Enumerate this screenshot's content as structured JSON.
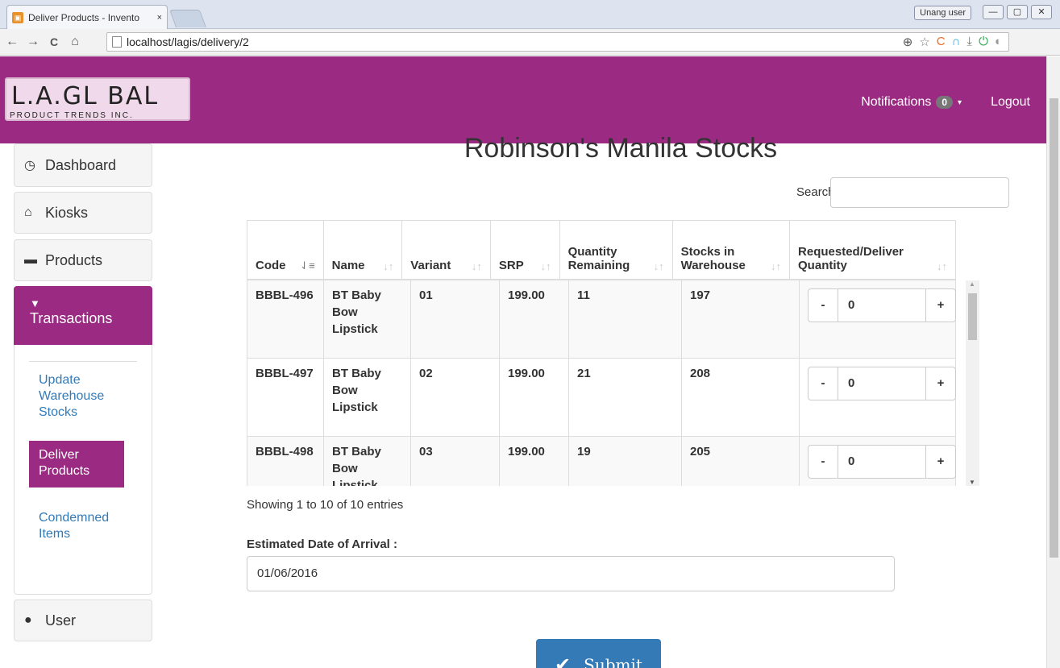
{
  "browser": {
    "tab_title": "Deliver Products - Invento",
    "tab_close": "×",
    "favicon": "📦",
    "user_chip": "Unang user",
    "win_min": "—",
    "win_max": "▢",
    "win_close": "✕",
    "back": "←",
    "forward": "→",
    "reload": "C",
    "home": "⌂",
    "url": "localhost/lagis/delivery/2",
    "menu": "≡"
  },
  "header": {
    "logo_big": "L.A.GL BAL",
    "logo_small": "PRODUCT TRENDS INC.",
    "notifications_label": "Notifications",
    "notifications_count": "0",
    "caret": "▾",
    "logout": "Logout"
  },
  "sidebar": {
    "dashboard": "Dashboard",
    "kiosks": "Kiosks",
    "products": "Products",
    "transactions": "Transactions",
    "sub": {
      "update_warehouse": "Update Warehouse Stocks",
      "deliver_products": "Deliver Products",
      "condemned_items": "Condemned Items"
    },
    "user": "User",
    "icons": {
      "dashboard": "◷",
      "kiosks": "⌂",
      "products": "▬",
      "transactions": "🛒",
      "user": "●"
    }
  },
  "main": {
    "title": "Robinson's Manila Stocks",
    "search_label": "Search:",
    "columns": [
      "Code",
      "Name",
      "Variant",
      "SRP",
      "Quantity Remaining",
      "Stocks in Warehouse",
      "Requested/Deliver Quantity"
    ],
    "rows": [
      {
        "code": "BBBL-496",
        "name": "BT Baby Bow Lipstick",
        "variant": "01",
        "srp": "199.00",
        "qty": "11",
        "stocks": "197",
        "req": "0"
      },
      {
        "code": "BBBL-497",
        "name": "BT Baby Bow Lipstick",
        "variant": "02",
        "srp": "199.00",
        "qty": "21",
        "stocks": "208",
        "req": "0"
      },
      {
        "code": "BBBL-498",
        "name": "BT Baby Bow Lipstick",
        "variant": "03",
        "srp": "199.00",
        "qty": "19",
        "stocks": "205",
        "req": "0"
      }
    ],
    "minus": "-",
    "plus": "+",
    "entries": "Showing 1 to 10 of 10 entries",
    "eda_label": "Estimated Date of Arrival :",
    "eda_value": "01/06/2016",
    "submit": "Submit"
  },
  "colors": {
    "brand": "#9b2a82",
    "link": "#337ab7",
    "submit": "#337ab7"
  }
}
